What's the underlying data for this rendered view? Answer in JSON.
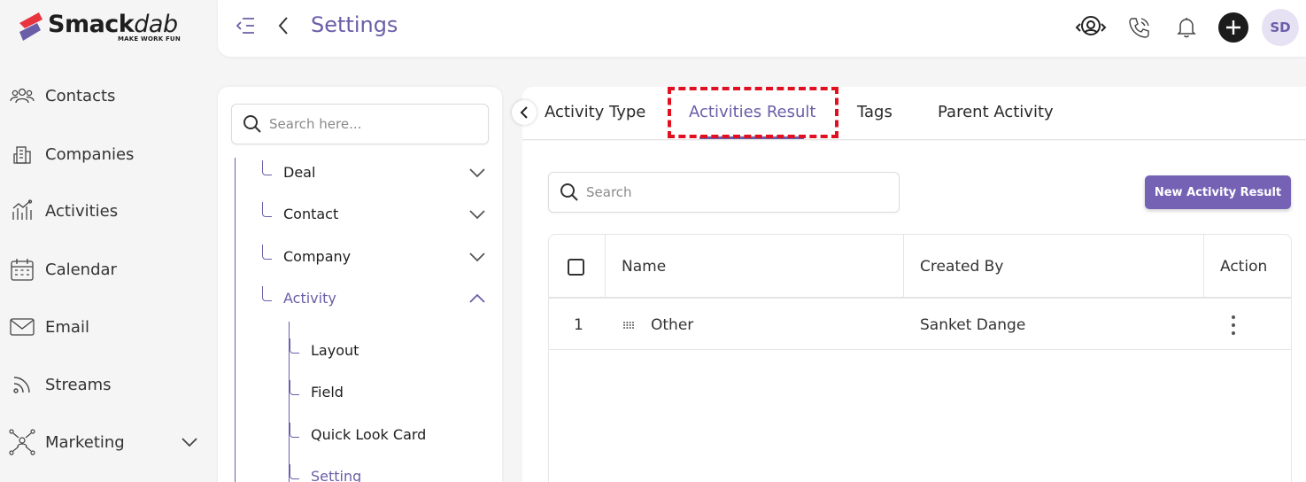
{
  "brand": {
    "name_main": "Smack",
    "name_tail": "dab",
    "tagline": "MAKE WORK FUN",
    "accent": "#6b5ea8",
    "logo_red": "#e8343f"
  },
  "sidebar": {
    "items": [
      {
        "label": "Contacts",
        "icon": "contacts-icon"
      },
      {
        "label": "Companies",
        "icon": "companies-icon"
      },
      {
        "label": "Activities",
        "icon": "activities-icon"
      },
      {
        "label": "Calendar",
        "icon": "calendar-icon"
      },
      {
        "label": "Email",
        "icon": "email-icon"
      },
      {
        "label": "Streams",
        "icon": "streams-icon"
      },
      {
        "label": "Marketing",
        "icon": "marketing-icon"
      }
    ]
  },
  "header": {
    "title": "Settings",
    "avatar_initials": "SD"
  },
  "settings_tree": {
    "search_placeholder": "Search here...",
    "items": [
      {
        "label": "Deal",
        "expanded": false
      },
      {
        "label": "Contact",
        "expanded": false
      },
      {
        "label": "Company",
        "expanded": false
      },
      {
        "label": "Activity",
        "expanded": true,
        "active": true
      }
    ],
    "subitems": [
      {
        "label": "Layout"
      },
      {
        "label": "Field"
      },
      {
        "label": "Quick Look Card"
      },
      {
        "label": "Setting",
        "active": true
      }
    ]
  },
  "tabs": [
    {
      "label": "Activity Type"
    },
    {
      "label": "Activities Result",
      "active": true
    },
    {
      "label": "Tags"
    },
    {
      "label": "Parent Activity"
    }
  ],
  "main": {
    "search_placeholder": "Search",
    "new_button_label": "New Activity Result",
    "table": {
      "columns": [
        "Name",
        "Created By",
        "Action"
      ],
      "rows": [
        {
          "index": "1",
          "name": "Other",
          "created_by": "Sanket Dange"
        }
      ]
    }
  }
}
